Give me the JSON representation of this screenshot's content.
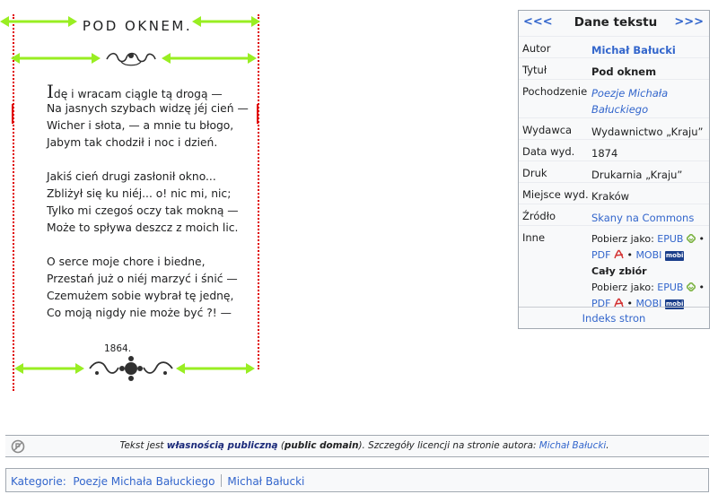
{
  "poem": {
    "title": "POD OKNEM.",
    "dropcap": "I",
    "stanzas": [
      [
        "dę i wracam ciągle tą drogą —",
        "Na jasnych szybach widzę jéj cień —",
        "Wicher i słota, — a mnie tu błogo,",
        "Jabym tak chodził i noc i dzień."
      ],
      [
        "Jakiś cień drugi zasłonił okno...",
        "Zbliżył się ku niéj... o! nic mi, nic;",
        "Tylko mi czegoś oczy tak mokną —",
        "Może to spływa deszcz z moich lic."
      ],
      [
        "O serce moje chore i biedne,",
        "Przestań już o niéj marzyć i śnić —",
        "Czemużem sobie wybrał tę jednę,",
        "Co moją nigdy nie może być ?! —"
      ]
    ],
    "year": "1864.",
    "colors": {
      "arrow": "#99ee22",
      "guide": "#e00000"
    }
  },
  "infobox": {
    "prev": "<<<",
    "title": "Dane tekstu",
    "next": ">>>",
    "rows": [
      {
        "label": "Autor",
        "value": "Michał Bałucki"
      },
      {
        "label": "Tytuł",
        "value": "Pod oknem"
      },
      {
        "label": "Pochodzenie",
        "value": "Poezje Michała Bałuckiego"
      },
      {
        "label": "Wydawca",
        "value": "Wydawnictwo „Kraju”"
      },
      {
        "label": "Data wyd.",
        "value": "1874"
      },
      {
        "label": "Druk",
        "value": "Drukarnia „Kraju”"
      },
      {
        "label": "Miejsce wyd.",
        "value": "Kraków"
      },
      {
        "label": "Źródło",
        "value": "Skany na Commons"
      },
      {
        "label": "Inne",
        "value": ""
      }
    ],
    "download": {
      "prefix": "Pobierz jako:",
      "epub": "EPUB",
      "pdf": "PDF",
      "mobi": "MOBI",
      "mobi_badge": "mobi",
      "bullet": "•",
      "whole": "Cały zbiór"
    },
    "footer": "Indeks stron"
  },
  "license": {
    "pre": "Tekst jest ",
    "link": "własnością publiczną",
    "mid1": " (",
    "pd": "public domain",
    "mid2": "). Szczegóły licencji na stronie autora: ",
    "author": "Michał Bałucki",
    "end": "."
  },
  "categories": {
    "label": "Kategorie",
    "colon": ":",
    "items": [
      "Poezje Michała Bałuckiego",
      "Michał Bałucki"
    ]
  }
}
